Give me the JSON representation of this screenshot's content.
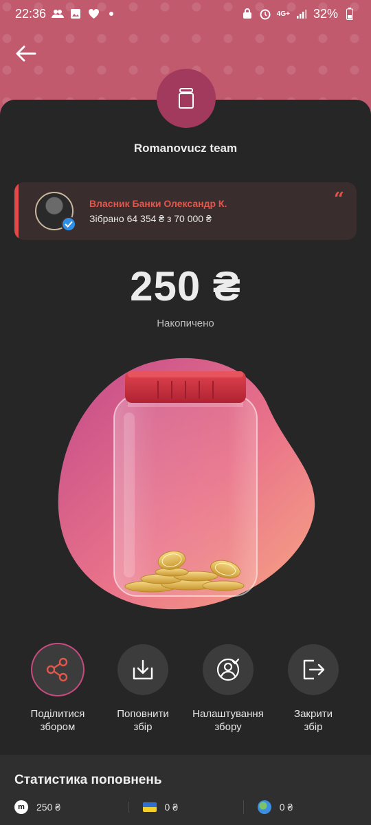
{
  "status_bar": {
    "time": "22:36",
    "battery": "32%",
    "network": "4G+"
  },
  "header": {
    "back_icon": "arrow-left-icon",
    "jar_icon": "jar-icon",
    "team_name": "Romanovucz team"
  },
  "owner_card": {
    "title": "Власник Банки Олександр К.",
    "raised": "Зібрано 64 354 ₴ з 70 000 ₴",
    "quote": "“"
  },
  "balance": {
    "amount": "250 ₴",
    "label": "Накопичено"
  },
  "actions": [
    {
      "label": "Поділитися\nзбором",
      "icon": "share-icon"
    },
    {
      "label": "Поповнити\nзбір",
      "icon": "download-tray-icon"
    },
    {
      "label": "Налаштування\nзбору",
      "icon": "settings-user-icon"
    },
    {
      "label": "Закрити\nзбір",
      "icon": "exit-icon"
    }
  ],
  "stats": {
    "title": "Статистика поповнень",
    "items": [
      {
        "icon": "monobank-icon",
        "badge": "m",
        "value": "250 ₴"
      },
      {
        "icon": "ukraine-flag-icon",
        "value": "0 ₴"
      },
      {
        "icon": "globe-icon",
        "value": "0 ₴"
      }
    ]
  },
  "colors": {
    "header": "#c25a6e",
    "background": "#262626",
    "accent_red": "#e2574c",
    "jar_avatar": "#a23a5e"
  }
}
